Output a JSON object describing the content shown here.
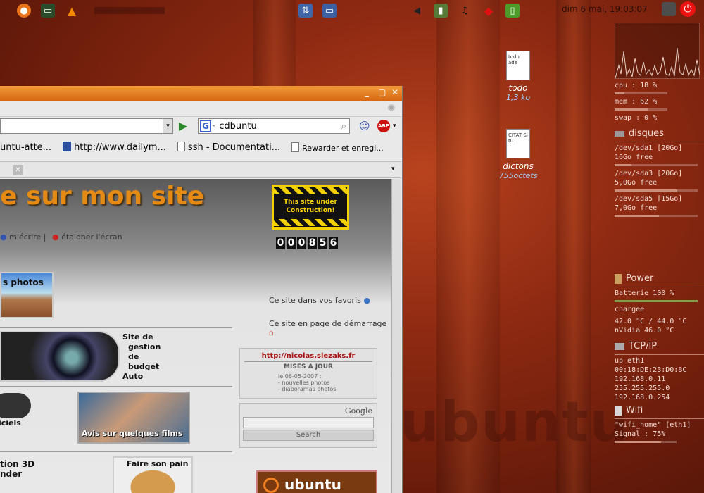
{
  "topbar": {
    "left_icons": [
      "firefox-icon",
      "terminal-icon",
      "vlc-icon"
    ],
    "center_icons": [
      "network-icon",
      "display-icon"
    ],
    "right_icons": [
      "volume-icon",
      "battery-applet-icon",
      "ruby-icon",
      "battery-icon"
    ],
    "clock": "dim 6 mai, 19:03:07"
  },
  "desktop": {
    "icons": [
      {
        "name": "todo",
        "sub": "1,3 ko",
        "doc_text": "todo ade"
      },
      {
        "name": "dictons",
        "sub": "755octets",
        "doc_text": "CITAT Si tu"
      }
    ],
    "wordmark": "ubuntu"
  },
  "conky": {
    "cpu": "cpu : 18 %",
    "cpu_pct": 18,
    "mem": "mem : 62 %",
    "mem_pct": 62,
    "swap": "swap : 0 %",
    "disks_title": "disques",
    "disks": [
      {
        "name": "/dev/sda1 [20Go]",
        "free": "16Go free",
        "used_pct": 20
      },
      {
        "name": "/dev/sda3 [20Go]",
        "free": "5,0Go free",
        "used_pct": 75
      },
      {
        "name": "/dev/sda5 [15Go]",
        "free": "7,0Go free",
        "used_pct": 53
      }
    ],
    "power_title": "Power",
    "battery": "Batterie 100 %",
    "battery_pct": 100,
    "charge": "chargee",
    "temp": "42.0 °C / 44.0 °C",
    "nvidia": "nVidia 46.0 °C",
    "tcp_title": "TCP/IP",
    "net": [
      "up eth1",
      "00:18:DE:23:D0:BC",
      "192.168.0.11",
      "255.255.255.0",
      "192.168.0.254"
    ],
    "wifi_title": "Wifi",
    "wifi": [
      "\"wifi_home\" [eth1]",
      "Signal : 75%"
    ],
    "wifi_pct": 75
  },
  "browser": {
    "search_value": "cdbuntu",
    "bookmarks": [
      "untu-atte...",
      "http://www.dailym...",
      "ssh - Documentati...",
      "Rewarder et enregi..."
    ],
    "page": {
      "banner": "e sur mon site",
      "construction": "This site under Construction!",
      "counter": [
        "0",
        "0",
        "0",
        "8",
        "5",
        "6"
      ],
      "link_write": "m'écrire",
      "link_calibrate": "étaloner l'écran",
      "photos": "s photos",
      "fav": "Ce site dans vos favoris",
      "home": "Ce site en page de démarrage",
      "budget": [
        "Site de",
        "gestion",
        "de",
        "budget",
        "Auto"
      ],
      "news_url": "http://nicolas.slezaks.fr",
      "news_title": "MISES A JOUR",
      "news_items": [
        "le 06-05-2007 :",
        "- nouvelles photos",
        "- diaporamas photos"
      ],
      "films": "Avis sur quelques films",
      "google": "Google",
      "search_btn": "Search",
      "ciels": "iciels",
      "pain": "Faire son pain",
      "tion3d": "tion 3D",
      "nder": "nder",
      "ubuntu_badge": "ubuntu"
    }
  }
}
